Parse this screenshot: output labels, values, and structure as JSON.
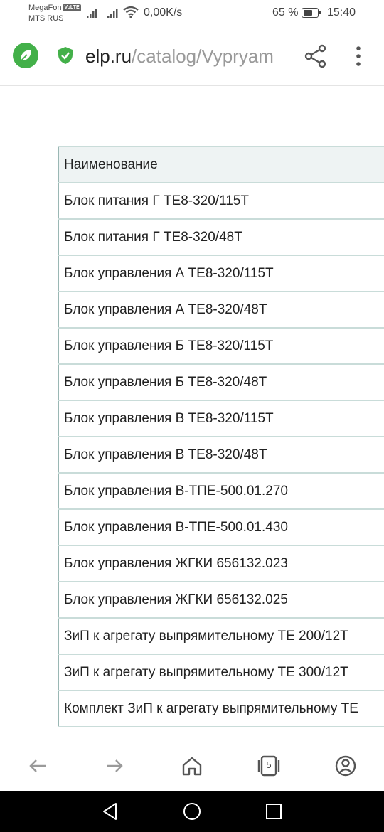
{
  "status_bar": {
    "carrier1": "MegaFon",
    "volte": "VoLTE",
    "carrier2": "MTS RUS",
    "net_speed": "0,00K/s",
    "battery_percent": "65 %",
    "battery_level": 0.65,
    "time": "15:40"
  },
  "browser": {
    "url_host": "elp.ru",
    "url_path": "/catalog/Vypryam",
    "icons": [
      "leaf-icon",
      "secure-shield-icon",
      "share-icon",
      "more-menu-icon"
    ],
    "tab_count": "5"
  },
  "table": {
    "header": "Наименование",
    "rows": [
      "Блок питания Г ТЕ8-320/115Т",
      "Блок питания Г ТЕ8-320/48Т",
      "Блок управления А ТЕ8-320/115Т",
      "Блок управления А ТЕ8-320/48Т",
      "Блок управления Б ТЕ8-320/115Т",
      "Блок управления Б ТЕ8-320/48Т",
      "Блок управления В ТЕ8-320/115Т",
      "Блок управления В ТЕ8-320/48Т",
      "Блок управления В-ТПЕ-500.01.270",
      "Блок управления В-ТПЕ-500.01.430",
      "Блок управления ЖГКИ 656132.023",
      "Блок управления ЖГКИ 656132.025",
      "ЗиП к агрегату выпрямительному ТЕ 200/12Т",
      "ЗиП к агрегату выпрямительному ТЕ 300/12Т",
      "Комплект ЗиП к агрегату выпрямительному ТЕ"
    ]
  },
  "colors": {
    "brand_green": "#43b049",
    "table_border": "#c9dcd9",
    "header_bg": "#eef3f3"
  }
}
